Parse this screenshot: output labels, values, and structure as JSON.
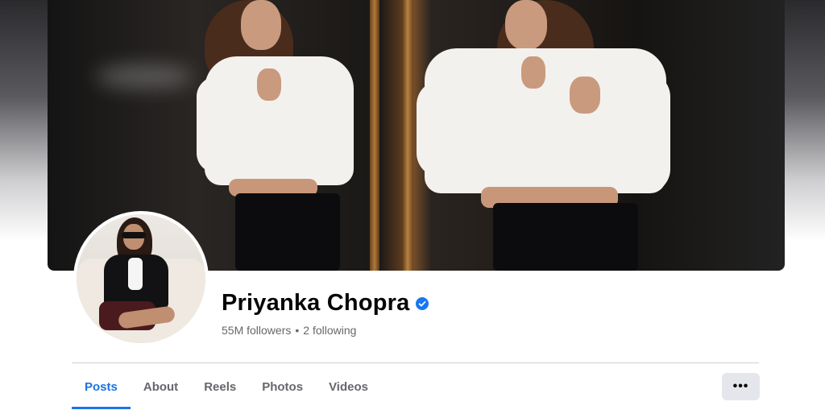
{
  "profile": {
    "name": "Priyanka Chopra",
    "followers_text": "55M followers",
    "separator": "•",
    "following_text": "2 following",
    "verified_badge_icon": "verified-badge-icon"
  },
  "tabs": [
    {
      "label": "Posts",
      "active": true
    },
    {
      "label": "About",
      "active": false
    },
    {
      "label": "Reels",
      "active": false
    },
    {
      "label": "Photos",
      "active": false
    },
    {
      "label": "Videos",
      "active": false
    }
  ],
  "more_button": {
    "label": "•••",
    "icon": "more-horizontal-icon"
  },
  "colors": {
    "accent": "#1b74e4",
    "verified": "#1877f2",
    "text_primary": "#050505",
    "text_secondary": "#65676b",
    "button_bg": "#e4e6eb"
  }
}
